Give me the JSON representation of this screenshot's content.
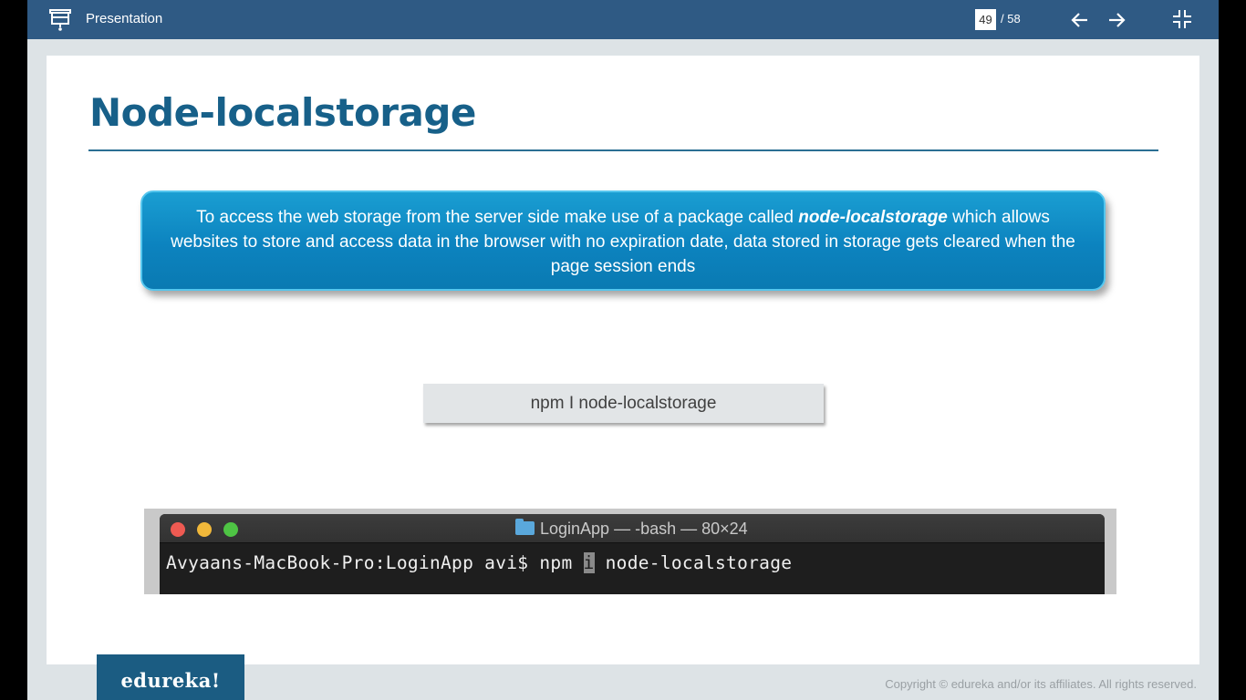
{
  "header": {
    "title": "Presentation",
    "current_page": "49",
    "total_pages": "/ 58"
  },
  "slide": {
    "title": "Node-localstorage",
    "callout": {
      "before": "To access the web storage from the server side make use of a package called ",
      "highlight": "node-localstorage",
      "after": " which allows websites to store and access data in the browser with no expiration date, data stored in storage gets cleared when the page session ends"
    },
    "command": "npm I node-localstorage",
    "terminal": {
      "title": "LoginApp — -bash — 80×24",
      "prompt": "Avyaans-MacBook-Pro:LoginApp avi$ npm ",
      "cursor_char": "i",
      "rest": " node-localstorage"
    }
  },
  "footer": {
    "logo": "edureka!",
    "copyright": "Copyright © edureka and/or its affiliates. All rights reserved."
  },
  "colors": {
    "topbar": "#2f5a84",
    "title": "#176089",
    "callout": "#0c83bf",
    "logo_bg": "#1b5c82"
  },
  "icons": [
    "presentation-icon",
    "arrow-left-icon",
    "arrow-right-icon",
    "exit-fullscreen-icon",
    "folder-icon"
  ]
}
